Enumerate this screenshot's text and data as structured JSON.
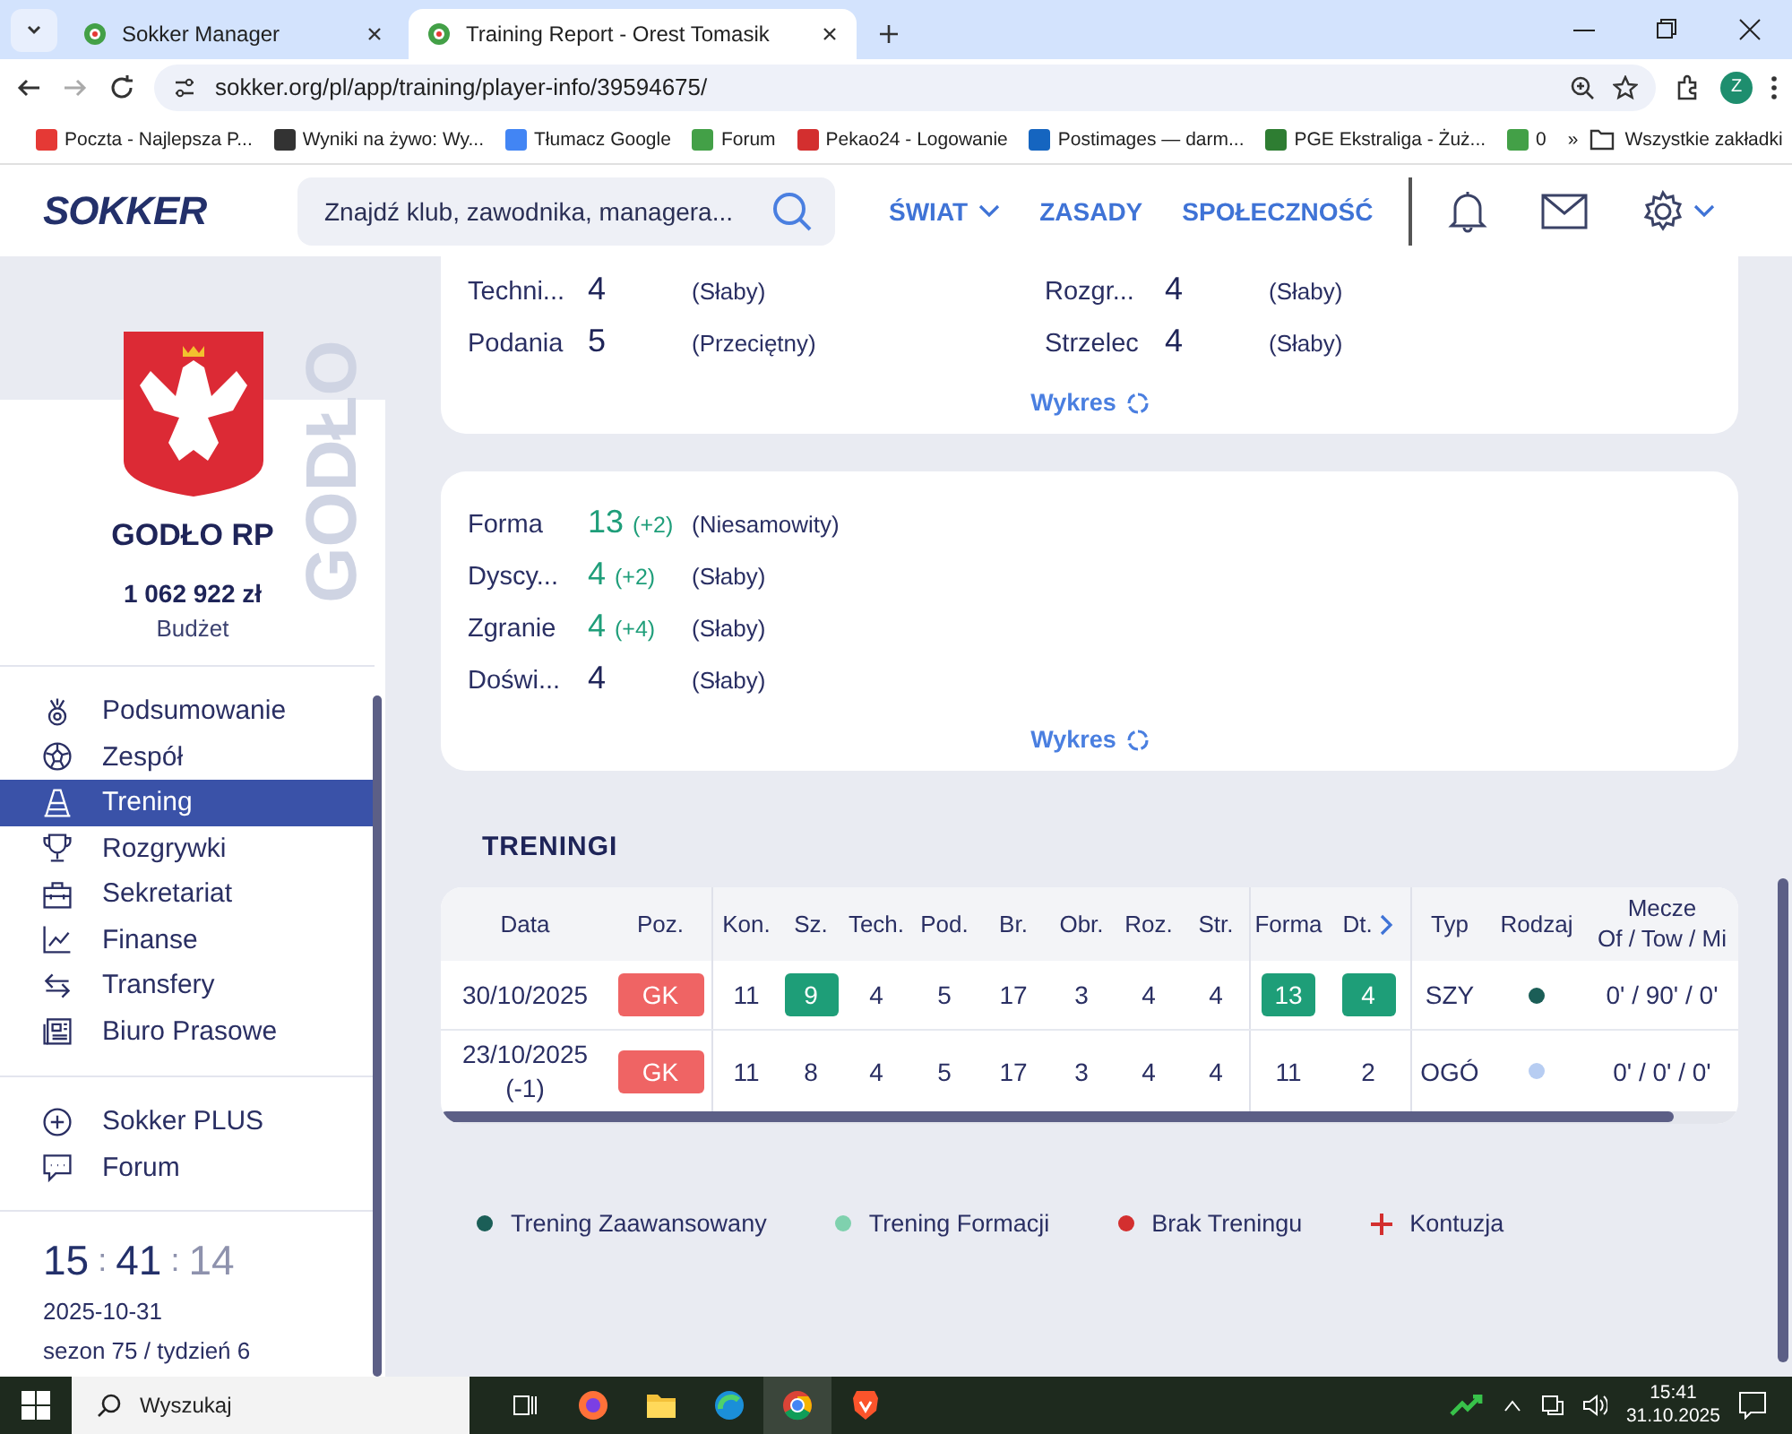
{
  "browser": {
    "tabs": [
      {
        "title": "Sokker Manager",
        "selected": false
      },
      {
        "title": "Training Report - Orest Tomasik",
        "selected": true
      }
    ],
    "url": "sokker.org/pl/app/training/player-info/39594675/",
    "profile": "Z",
    "bookmarks": [
      {
        "label": "Poczta - Najlepsza P...",
        "color": "#e53935"
      },
      {
        "label": "Wyniki na żywo: Wy...",
        "color": "#333333"
      },
      {
        "label": "Tłumacz Google",
        "color": "#4285f4"
      },
      {
        "label": "Forum",
        "color": "#43a047"
      },
      {
        "label": "Pekao24 - Logowanie",
        "color": "#d32f2f"
      },
      {
        "label": "Postimages — darm...",
        "color": "#1565c0"
      },
      {
        "label": "PGE Ekstraliga - Żuż...",
        "color": "#2e7d32"
      },
      {
        "label": "0",
        "color": "#43a047"
      }
    ],
    "more": "»",
    "all_bookmarks": "Wszystkie zakładki"
  },
  "header": {
    "logo": "SOKKER",
    "search_placeholder": "Znajdź klub, zawodnika, managera...",
    "nav": [
      {
        "label": "ŚWIAT",
        "dropdown": true
      },
      {
        "label": "ZASADY",
        "dropdown": false
      },
      {
        "label": "SPOŁECZNOŚĆ",
        "dropdown": false
      }
    ]
  },
  "sidebar": {
    "club": "GODŁO RP",
    "watermark": "GODŁO",
    "budget": "1 062 922 zł",
    "budget_label": "Budżet",
    "menu": [
      {
        "label": "Podsumowanie",
        "selected": false
      },
      {
        "label": "Zespół",
        "selected": false
      },
      {
        "label": "Trening",
        "selected": true
      },
      {
        "label": "Rozgrywki",
        "selected": false
      },
      {
        "label": "Sekretariat",
        "selected": false
      },
      {
        "label": "Finanse",
        "selected": false
      },
      {
        "label": "Transfery",
        "selected": false
      },
      {
        "label": "Biuro Prasowe",
        "selected": false
      }
    ],
    "extra": [
      {
        "label": "Sokker PLUS"
      },
      {
        "label": "Forum"
      }
    ],
    "clock": {
      "hours": "15",
      "minutes": "41",
      "seconds": "14",
      "separator": ":"
    },
    "date": "2025-10-31",
    "season": "sezon 75 / tydzień 6"
  },
  "skills": {
    "rows": [
      [
        {
          "label": "Techni...",
          "value": "4",
          "desc": "(Słaby)"
        },
        {
          "label": "Rozgr...",
          "value": "4",
          "desc": "(Słaby)"
        }
      ],
      [
        {
          "label": "Podania",
          "value": "5",
          "desc": "(Przeciętny)"
        },
        {
          "label": "Strzelec",
          "value": "4",
          "desc": "(Słaby)"
        }
      ]
    ],
    "chart_link": "Wykres"
  },
  "form": {
    "rows": [
      {
        "label": "Forma",
        "value": "13",
        "change": "(+2)",
        "desc": "(Niesamowity)"
      },
      {
        "label": "Dyscy...",
        "value": "4",
        "change": "(+2)",
        "desc": "(Słaby)"
      },
      {
        "label": "Zgranie",
        "value": "4",
        "change": "(+4)",
        "desc": "(Słaby)"
      },
      {
        "label": "Doświ...",
        "value": "4",
        "desc": "(Słaby)"
      }
    ],
    "chart_link": "Wykres"
  },
  "trainings": {
    "title": "TRENINGI",
    "columns": [
      {
        "label": "Data"
      },
      {
        "label": "Poz."
      },
      {
        "label": "Kon."
      },
      {
        "label": "Sz."
      },
      {
        "label": "Tech."
      },
      {
        "label": "Pod."
      },
      {
        "label": "Br."
      },
      {
        "label": "Obr."
      },
      {
        "label": "Roz."
      },
      {
        "label": "Str."
      },
      {
        "label": "Forma"
      },
      {
        "label": "Dt.",
        "arrow": true
      },
      {
        "label": "Typ"
      },
      {
        "label": "Rodzaj"
      },
      {
        "label": "Mecze",
        "sublabel": "Of / Tow / Mi"
      }
    ],
    "rows": [
      {
        "date": "30/10/2025",
        "position": "GK",
        "values": [
          {
            "value": "11",
            "highlight": false
          },
          {
            "value": "9",
            "highlight": true
          },
          {
            "value": "4",
            "highlight": false
          },
          {
            "value": "5",
            "highlight": false
          },
          {
            "value": "17",
            "highlight": false
          },
          {
            "value": "3",
            "highlight": false
          },
          {
            "value": "4",
            "highlight": false
          },
          {
            "value": "4",
            "highlight": false
          },
          {
            "value": "13",
            "highlight": true
          },
          {
            "value": "4",
            "highlight": true
          }
        ],
        "type": "SZY",
        "color": "#1b5e57",
        "matches": "0' / 90' / 0'"
      },
      {
        "date": "23/10/2025",
        "date_note": "(-1)",
        "position": "GK",
        "values": [
          {
            "value": "11",
            "highlight": false
          },
          {
            "value": "8",
            "highlight": false
          },
          {
            "value": "4",
            "highlight": false
          },
          {
            "value": "5",
            "highlight": false
          },
          {
            "value": "17",
            "highlight": false
          },
          {
            "value": "3",
            "highlight": false
          },
          {
            "value": "4",
            "highlight": false
          },
          {
            "value": "4",
            "highlight": false
          },
          {
            "value": "11",
            "highlight": false
          },
          {
            "value": "2",
            "highlight": false
          }
        ],
        "type": "OGÓ",
        "color": "#b7cdf2",
        "matches": "0' / 0' / 0'"
      }
    ]
  },
  "legend": [
    {
      "label": "Trening Zaawansowany",
      "kind": "dot",
      "color": "#1b5e57"
    },
    {
      "label": "Trening Formacji",
      "kind": "dot",
      "color": "#7fd1ae"
    },
    {
      "label": "Brak Treningu",
      "kind": "dot",
      "color": "#d32f2f"
    },
    {
      "label": "Kontuzja",
      "kind": "cross",
      "color": "#d32f2f"
    }
  ],
  "taskbar": {
    "search_placeholder": "Wyszukaj",
    "time": "15:41",
    "date": "31.10.2025"
  }
}
